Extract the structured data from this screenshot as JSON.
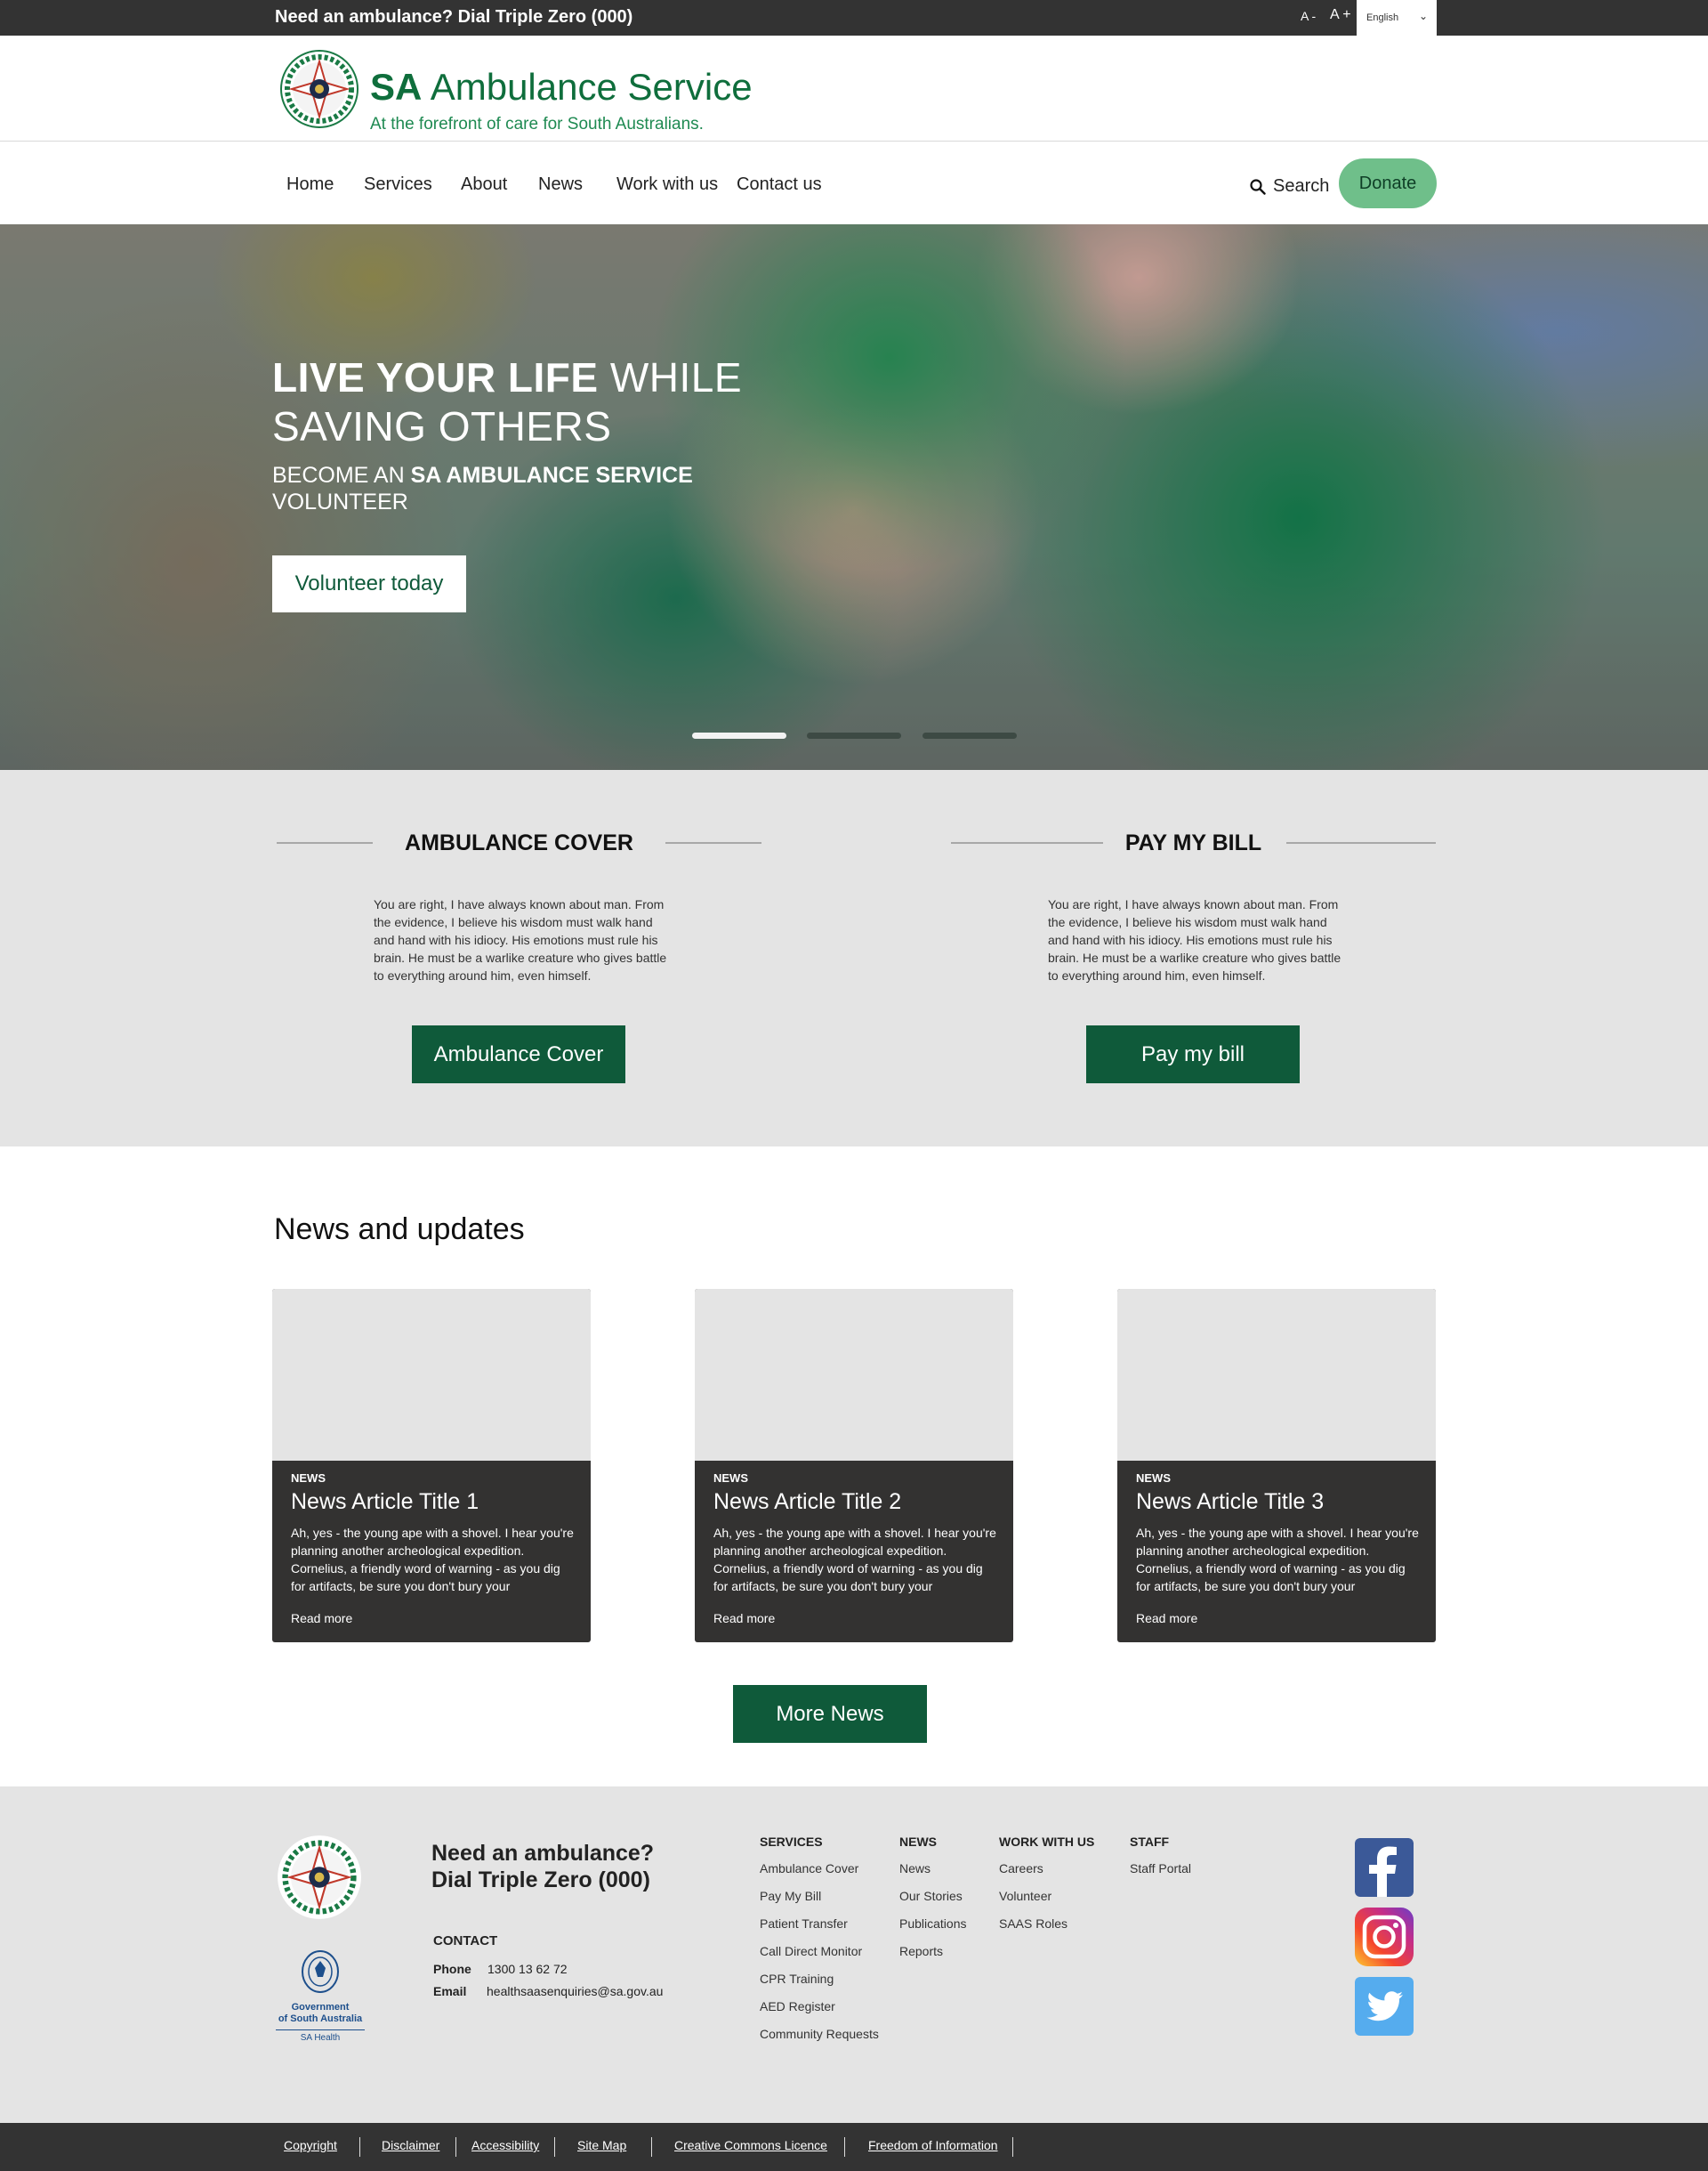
{
  "topbar": {
    "alert": "Need an ambulance? Dial Triple Zero (000)",
    "font_decrease": "A -",
    "font_increase": "A +",
    "language": "English"
  },
  "header": {
    "brand_bold": "SA",
    "brand_rest": " Ambulance Service",
    "tagline": "At the forefront of care for South Australians."
  },
  "nav": {
    "items": [
      "Home",
      "Services",
      "About",
      "News",
      "Work with us",
      "Contact us"
    ],
    "search": "Search",
    "donate": "Donate"
  },
  "hero": {
    "line1_bold": "LIVE YOUR LIFE",
    "line1_rest": " WHILE",
    "line2": "SAVING OTHERS",
    "sub_pre": "BECOME AN ",
    "sub_bold": "SA AMBULANCE SERVICE",
    "sub_post": "VOLUNTEER",
    "button": "Volunteer today",
    "slides": 3,
    "active_slide": 1
  },
  "quick_links": [
    {
      "heading": "AMBULANCE COVER",
      "text": "You are right, I have always known about man. From the evidence, I believe his wisdom must walk hand and hand with his idiocy. His emotions must rule his brain. He must be a warlike creature who gives battle to everything around him, even himself.",
      "button": "Ambulance Cover"
    },
    {
      "heading": "PAY MY BILL",
      "text": "You are right, I have always known about man. From the evidence, I believe his wisdom must walk hand and hand with his idiocy. His emotions must rule his brain. He must be a warlike creature who gives battle to everything around him, even himself.",
      "button": "Pay my bill"
    }
  ],
  "news": {
    "title": "News and updates",
    "articles": [
      {
        "tag": "NEWS",
        "title": "News Article Title 1",
        "body": "Ah, yes - the young ape with a shovel. I hear you're planning another archeological expedition. Cornelius, a friendly word of warning - as you dig for artifacts, be sure you don't bury your",
        "link": "Read more"
      },
      {
        "tag": "NEWS",
        "title": "News Article Title 2",
        "body": "Ah, yes - the young ape with a shovel. I hear you're planning another archeological expedition. Cornelius, a friendly word of warning - as you dig for artifacts, be sure you don't bury your",
        "link": "Read more"
      },
      {
        "tag": "NEWS",
        "title": "News Article Title 3",
        "body": "Ah, yes - the young ape with a shovel. I hear you're planning another archeological expedition. Cornelius, a friendly word of warning - as you dig for artifacts, be sure you don't bury your",
        "link": "Read more"
      }
    ],
    "more_button": "More News"
  },
  "footer": {
    "call_line1": "Need an ambulance?",
    "call_line2": "Dial Triple Zero (000)",
    "contact_heading": "CONTACT",
    "phone_label": "Phone",
    "phone": "1300 13 62 72",
    "email_label": "Email",
    "email": "healthsaasenquiries@sa.gov.au",
    "gov_line1": "Government",
    "gov_line2": "of South Australia",
    "gov_line3": "SA Health",
    "columns": [
      {
        "heading": "SERVICES",
        "links": [
          "Ambulance Cover",
          "Pay My Bill",
          "Patient Transfer",
          "Call Direct Monitor",
          "CPR Training",
          "AED Register",
          "Community Requests"
        ]
      },
      {
        "heading": "NEWS",
        "links": [
          "News",
          "Our Stories",
          "Publications",
          "Reports"
        ]
      },
      {
        "heading": "WORK WITH US",
        "links": [
          "Careers",
          "Volunteer",
          "SAAS Roles"
        ]
      },
      {
        "heading": "STAFF",
        "links": [
          "Staff Portal"
        ]
      }
    ],
    "social": [
      "facebook-icon",
      "instagram-icon",
      "twitter-icon"
    ],
    "bottom_links": [
      "Copyright",
      "Disclaimer",
      "Accessibility",
      "Site Map",
      "Creative Commons Licence",
      "Freedom of Information"
    ]
  },
  "colors": {
    "brand_green": "#0f6e3c",
    "button_green": "#0f5a3a",
    "donate_green": "#6fbf8a",
    "dark_bar": "#333333",
    "panel_grey": "#e4e4e4"
  }
}
